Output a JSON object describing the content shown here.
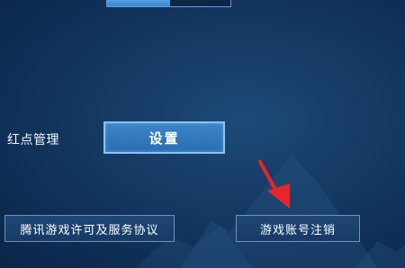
{
  "settings": {
    "red_dot_label": "红点管理",
    "settings_button": "设置",
    "license_button": "腾讯游戏许可及服务协议",
    "account_cancel_button": "游戏账号注销"
  },
  "icons": {
    "annotation": "red-arrow-icon"
  },
  "colors": {
    "primary_button": "#3d85c8",
    "annotation_arrow": "#e8252a"
  }
}
